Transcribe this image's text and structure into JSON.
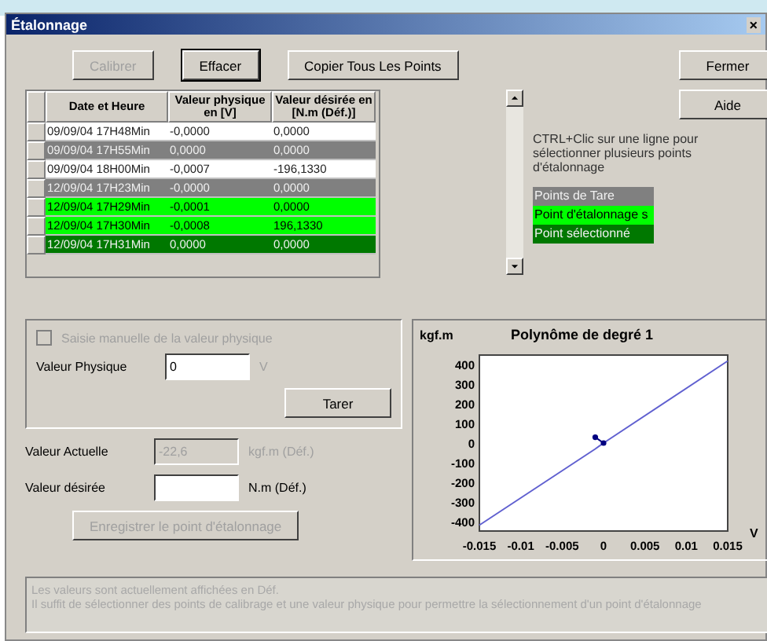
{
  "window": {
    "title": "Étalonnage",
    "close": "×"
  },
  "toolbar": [
    {
      "label": "Calibrer",
      "disabled": true,
      "focused": false
    },
    {
      "label": "Effacer",
      "disabled": false,
      "focused": true
    },
    {
      "label": "Copier Tous Les Points",
      "disabled": false,
      "focused": false
    }
  ],
  "side_buttons": [
    "Fermer",
    "Aide"
  ],
  "table": {
    "columns": [
      "Date et Heure",
      "Valeur physique en [V]",
      "Valeur désirée en [N.m (Déf.)]"
    ],
    "rows": [
      {
        "cells": [
          "09/09/04 17H48Min",
          "-0,0000",
          "0,0000"
        ],
        "kind": "normal"
      },
      {
        "cells": [
          "09/09/04 17H55Min",
          "0,0000",
          "0,0000"
        ],
        "kind": "tare"
      },
      {
        "cells": [
          "09/09/04 18H00Min",
          "-0,0007",
          "-196,1330"
        ],
        "kind": "normal"
      },
      {
        "cells": [
          "12/09/04 17H23Min",
          "-0,0000",
          "0,0000"
        ],
        "kind": "tare"
      },
      {
        "cells": [
          "12/09/04 17H29Min",
          "-0,0001",
          "0,0000"
        ],
        "kind": "calibration"
      },
      {
        "cells": [
          "12/09/04 17H30Min",
          "-0,0008",
          "196,1330"
        ],
        "kind": "calibration"
      },
      {
        "cells": [
          "12/09/04 17H31Min",
          "0,0000",
          "0,0000"
        ],
        "kind": "selected"
      }
    ]
  },
  "hint": "CTRL+Clic sur une ligne pour sélectionner plusieurs points d'étalonnage",
  "legend": [
    {
      "label": "Points de Tare",
      "color": "#808080"
    },
    {
      "label": "Point d'étalonnage s",
      "color": "#00ff00"
    },
    {
      "label": "Point sélectionné",
      "color": "#007800"
    }
  ],
  "manual": {
    "checkbox": {
      "label": "Saisie manuelle de la valeur physique",
      "checked": false,
      "disabled": true
    },
    "label": "Valeur Physique",
    "value": "0",
    "unit": "V",
    "button": "Tarer"
  },
  "current": {
    "label": "Valeur Actuelle",
    "value": "-22,6",
    "unit": "kgf.m (Déf.)",
    "disabled": true
  },
  "desired": {
    "label": "Valeur désirée",
    "unit": "N.m (Déf.)"
  },
  "save_button": {
    "label": "Enregistrer le point d'étalonnage",
    "disabled": true
  },
  "chart": {
    "chart_data": {
      "type": "line",
      "title": "Polynôme de degré 1",
      "ylabel": "kgf.m",
      "xlabel": "V",
      "x": [
        -0.015,
        -0.001,
        0,
        0.015
      ],
      "series": [
        {
          "color": "#6060d0",
          "values": [
            -420,
            -30,
            0,
            420
          ]
        },
        {
          "color": "#000080",
          "marker": "circle",
          "values": [
            null,
            30,
            0,
            null
          ]
        }
      ],
      "xlim": [
        -0.015,
        0.015
      ],
      "ylim": [
        -450,
        450
      ],
      "xticks": [
        -0.015,
        -0.01,
        -0.005,
        0,
        0.005,
        0.01,
        0.015
      ],
      "yticks": [
        -400,
        -300,
        -200,
        -100,
        0,
        100,
        200,
        300,
        400
      ]
    }
  },
  "message": [
    "Les valeurs sont actuellement affichées en Déf.",
    "Il suffit de sélectionner des points de calibrage et une valeur physique pour permettre la sélectionnement d'un point d'étalonnage"
  ]
}
